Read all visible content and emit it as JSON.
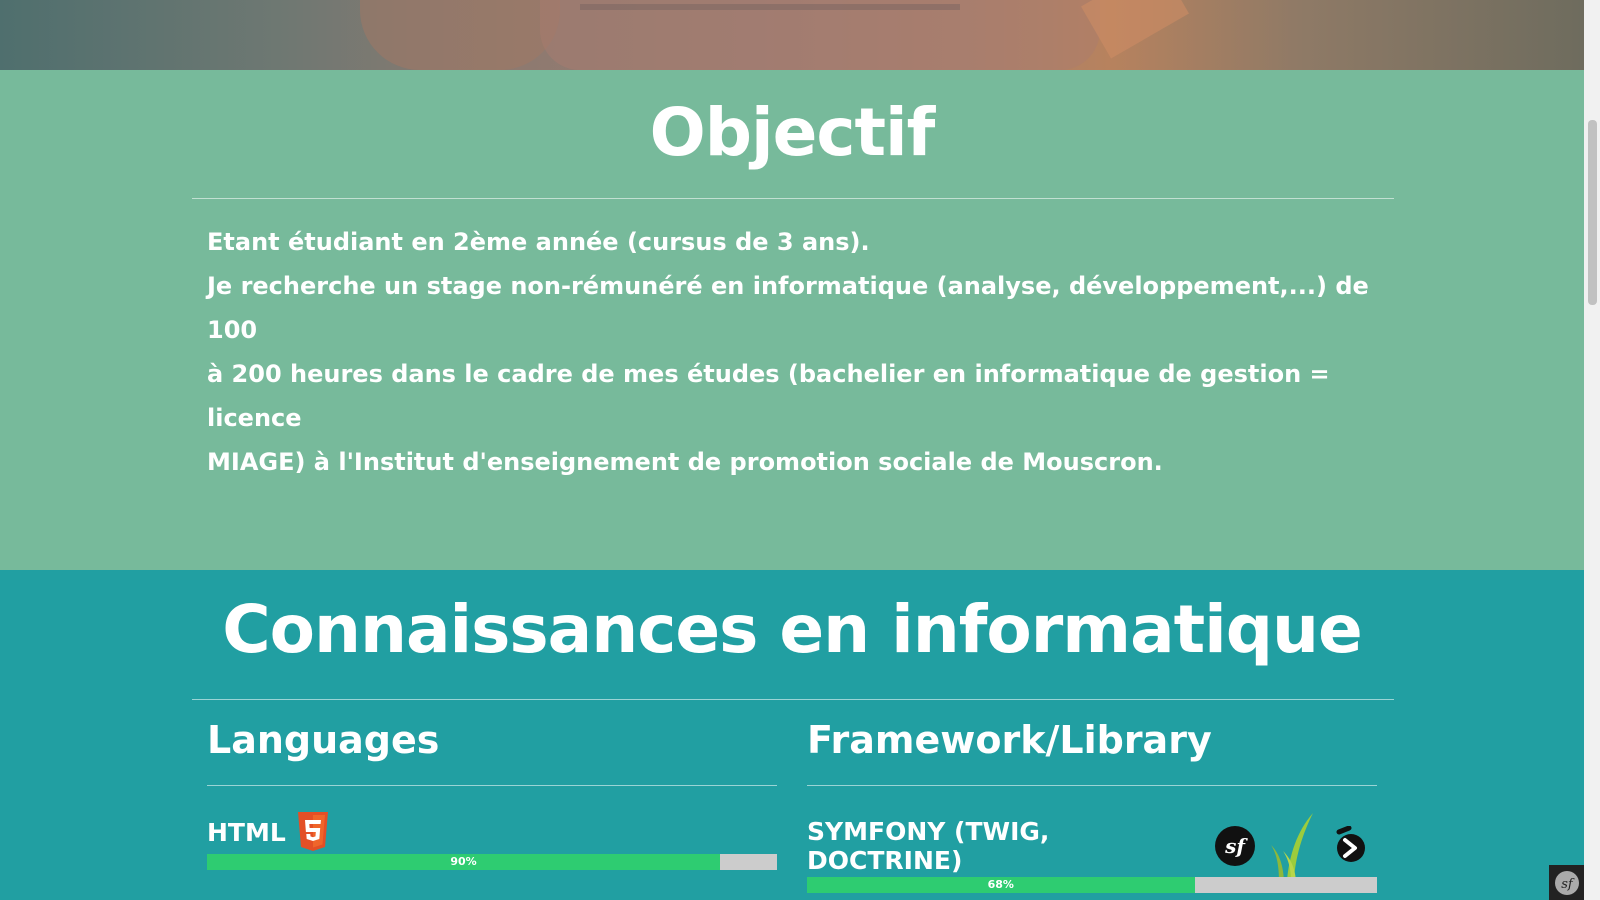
{
  "objectif": {
    "title": "Objectif",
    "lines": [
      "Etant étudiant en 2ème année (cursus de 3 ans).",
      "Je recherche un stage non-rémunéré en informatique (analyse, développement,...) de 100",
      "à 200 heures dans le cadre de mes études (bachelier en informatique de gestion = licence",
      "MIAGE) à l'Institut d'enseignement de promotion sociale de Mouscron."
    ]
  },
  "connaissances": {
    "title": "Connaissances en informatique",
    "languages": {
      "title": "Languages",
      "skills": [
        {
          "label": "HTML",
          "percent": 90,
          "percent_label": "90%",
          "icons": [
            "html5-icon"
          ]
        }
      ]
    },
    "frameworks": {
      "title": "Framework/Library",
      "skills": [
        {
          "label": "SYMFONY (TWIG, DOCTRINE)",
          "percent": 68,
          "percent_label": "68%",
          "icons": [
            "symfony-icon",
            "twig-icon",
            "doctrine-icon"
          ]
        }
      ]
    }
  },
  "colors": {
    "objectif_bg": "#77ba9b",
    "connaissances_bg": "#219fa2",
    "progress_fill": "#2ecc71",
    "progress_track": "#cccccc"
  }
}
